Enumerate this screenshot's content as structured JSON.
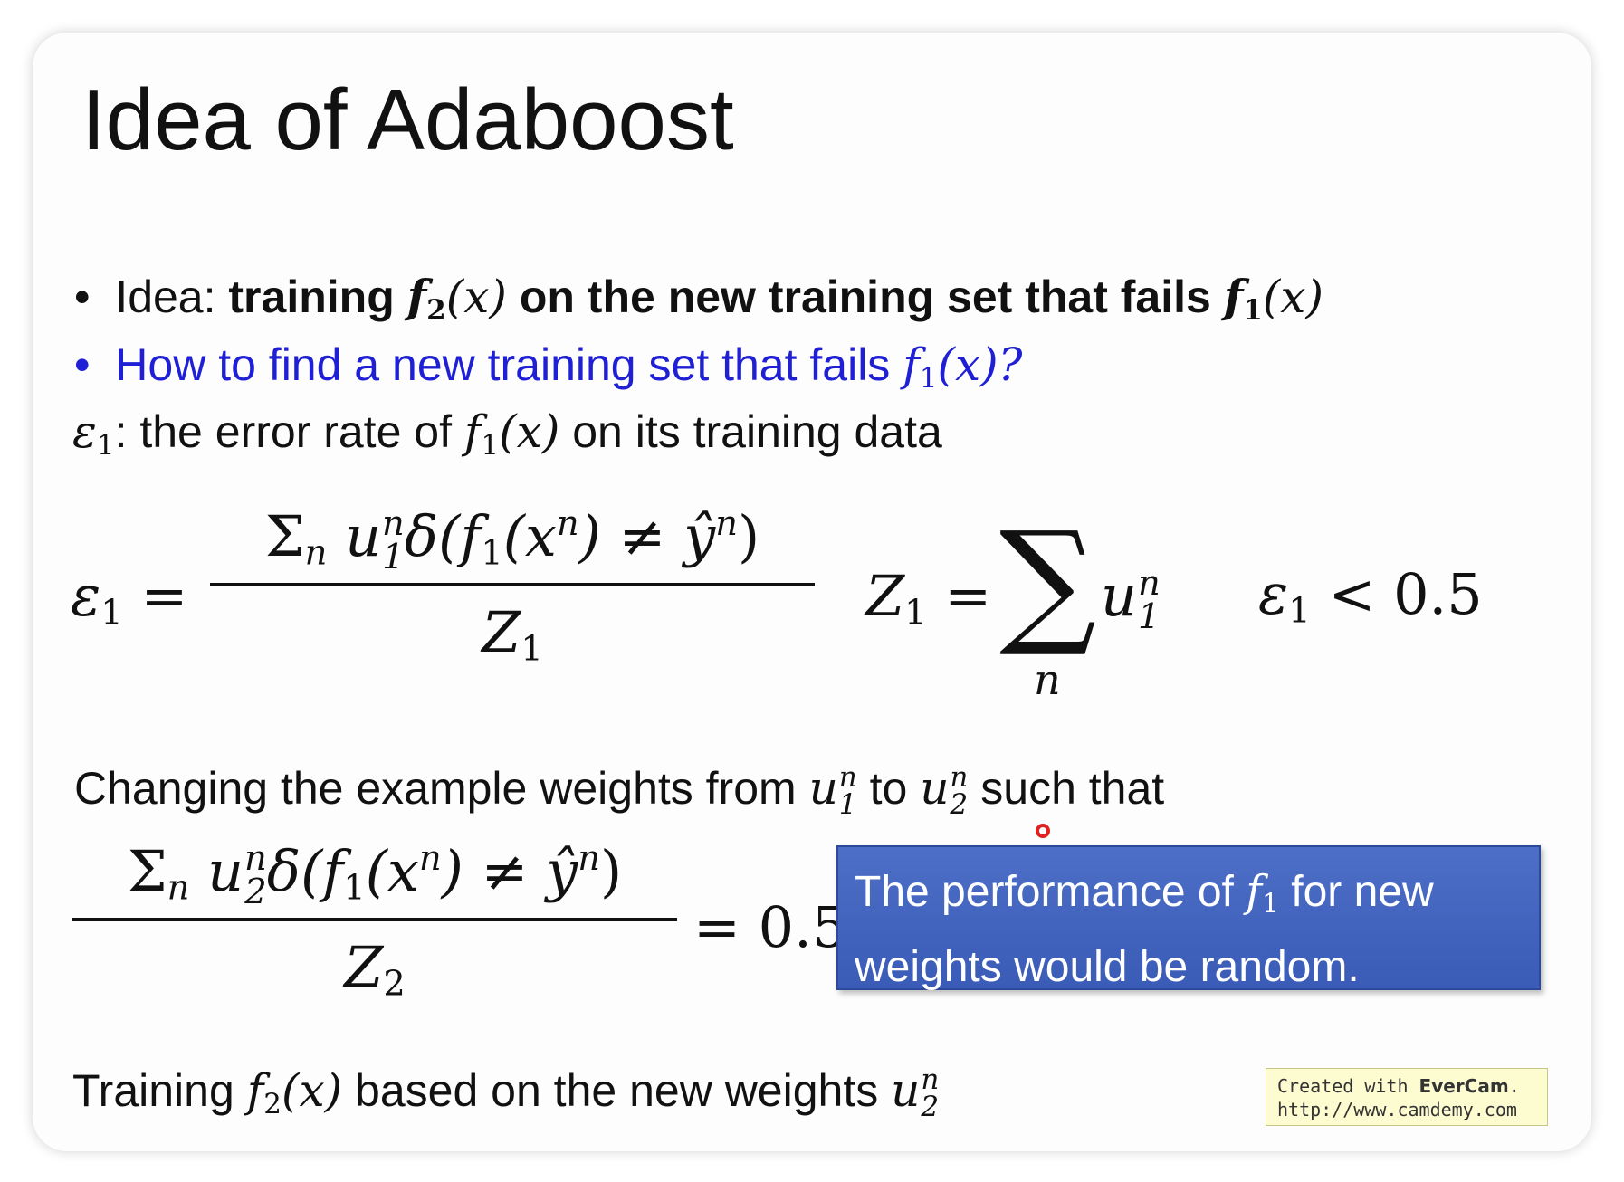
{
  "title": "Idea of Adaboost",
  "bullet1": {
    "prefix": "Idea: ",
    "bold_a": "training ",
    "f2": "f",
    "f2_sub": "2",
    "arg": "(x)",
    "bold_b": " on the new training set that fails ",
    "f1": "f",
    "f1_sub": "1",
    "arg2": "(x)"
  },
  "bullet2": {
    "text": "How to find a new training set that fails ",
    "f": "f",
    "sub": "1",
    "arg": "(x)?"
  },
  "epsilon_line": {
    "eps": "ε",
    "eps_sub": "1",
    "text_a": ": the error rate of ",
    "f": "f",
    "f_sub": "1",
    "arg": "(x)",
    "text_b": " on its training data"
  },
  "eq1": {
    "lhs": "ε",
    "lhs_sub": "1",
    "equals": "=",
    "numerator": "Σ",
    "num_sub": "n",
    "num_u": " u",
    "num_u_sup": "n",
    "num_u_sub": "1",
    "num_rest_a": "δ(f",
    "num_f_sub": "1",
    "num_rest_b": "(x",
    "num_x_sup": "n",
    "num_rest_c": ") ≠ ŷ",
    "num_y_sup": "n",
    "num_rest_d": ")",
    "den": "Z",
    "den_sub": "1"
  },
  "eq_z": {
    "lhs": "Z",
    "lhs_sub": "1",
    "equals": "=",
    "sum": "∑",
    "sum_sub": "n",
    "u": "u",
    "u_sup": "n",
    "u_sub": "1"
  },
  "eq_cond": {
    "eps": "ε",
    "eps_sub": "1",
    "rest": " < 0.5"
  },
  "changing_line": {
    "text_a": "Changing the example weights from ",
    "u1": "u",
    "u1_sup": "n",
    "u1_sub": "1",
    "text_b": " to ",
    "u2": "u",
    "u2_sup": "n",
    "u2_sub": "2",
    "text_c": " such that"
  },
  "eq2": {
    "numerator": "Σ",
    "num_sub": "n",
    "num_u": " u",
    "num_u_sup": "n",
    "num_u_sub": "2",
    "num_rest_a": "δ(f",
    "num_f_sub": "1",
    "num_rest_b": "(x",
    "num_x_sup": "n",
    "num_rest_c": ") ≠ ŷ",
    "num_y_sup": "n",
    "num_rest_d": ")",
    "den": "Z",
    "den_sub": "2",
    "rhs": "= 0.5"
  },
  "callout": {
    "text_a": "The performance of ",
    "f": "f",
    "f_sub": "1",
    "text_b": " for new",
    "line2": "weights would be random."
  },
  "training_line": {
    "text_a": "Training ",
    "f": "f",
    "f_sub": "2",
    "arg": "(x)",
    "text_b": " based on the new weights ",
    "u": "u",
    "u_sup": "n",
    "u_sub": "2"
  },
  "watermark": {
    "line1_a": "Created with ",
    "brand": "EverCam",
    "line1_b": ".",
    "line2": "http://www.camdemy.com"
  }
}
